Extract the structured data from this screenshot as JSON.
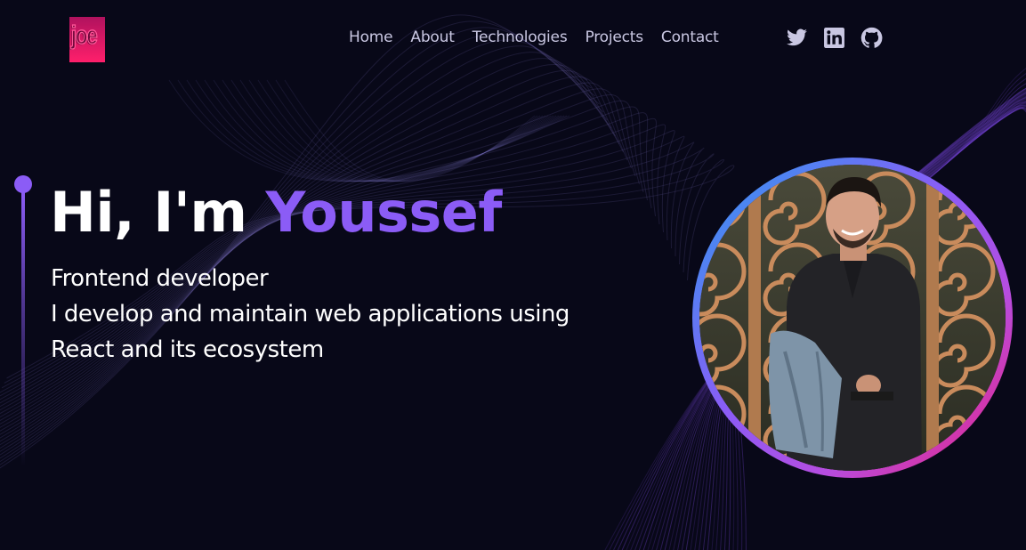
{
  "header": {
    "logo_text": "joe",
    "nav": [
      {
        "label": "Home"
      },
      {
        "label": "About"
      },
      {
        "label": "Technologies"
      },
      {
        "label": "Projects"
      },
      {
        "label": "Contact"
      }
    ],
    "social": [
      {
        "icon": "twitter-icon"
      },
      {
        "icon": "linkedin-icon"
      },
      {
        "icon": "github-icon"
      }
    ]
  },
  "hero": {
    "greeting": "Hi, I'm ",
    "name": "Youssef",
    "lines": [
      "Frontend developer",
      "I develop and maintain web applications using",
      "React and its ecosystem"
    ]
  },
  "colors": {
    "background": "#080818",
    "accent": "#8b5cf6",
    "nav_text": "#c9c7e2",
    "logo": "#ff1f6b",
    "ring_start": "#2b9bf0",
    "ring_end": "#ec1f7a"
  }
}
